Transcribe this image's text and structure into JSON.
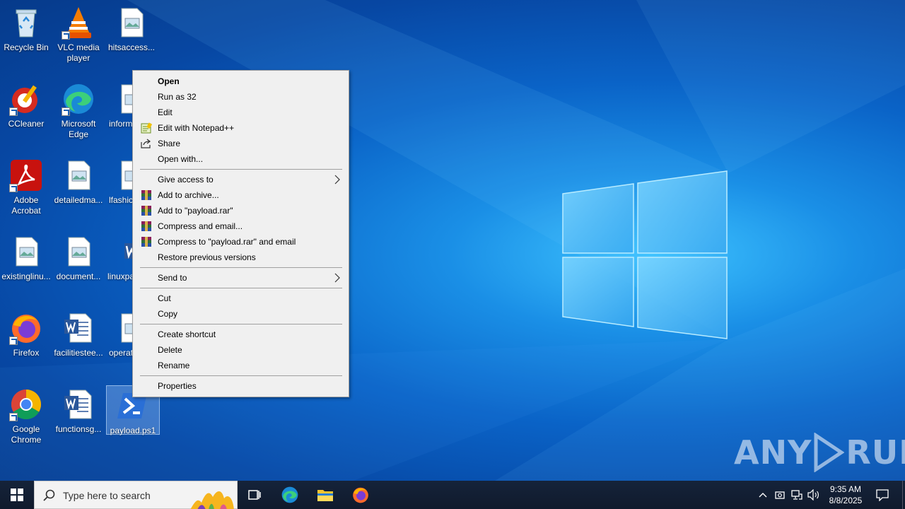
{
  "desktop": {
    "icons": [
      {
        "label": "Recycle Bin"
      },
      {
        "label": "VLC media player"
      },
      {
        "label": "hitsaccess..."
      },
      {
        "label": "CCleaner"
      },
      {
        "label": "Microsoft Edge"
      },
      {
        "label": "inform"
      },
      {
        "label": "Adobe Acrobat"
      },
      {
        "label": "detailedma..."
      },
      {
        "label": "lfashic"
      },
      {
        "label": "existinglinu..."
      },
      {
        "label": "document..."
      },
      {
        "label": "linuxpa"
      },
      {
        "label": "Firefox"
      },
      {
        "label": "facilitiestee..."
      },
      {
        "label": "operat"
      },
      {
        "label": "Google Chrome"
      },
      {
        "label": "functionsg..."
      },
      {
        "label": "payload.ps1"
      }
    ]
  },
  "context_menu": {
    "items": [
      {
        "label": "Open"
      },
      {
        "label": "Run as 32"
      },
      {
        "label": "Edit"
      },
      {
        "label": "Edit with Notepad++"
      },
      {
        "label": "Share"
      },
      {
        "label": "Open with..."
      },
      {
        "label": "Give access to"
      },
      {
        "label": "Add to archive..."
      },
      {
        "label": "Add to \"payload.rar\""
      },
      {
        "label": "Compress and email..."
      },
      {
        "label": "Compress to \"payload.rar\" and email"
      },
      {
        "label": "Restore previous versions"
      },
      {
        "label": "Send to"
      },
      {
        "label": "Cut"
      },
      {
        "label": "Copy"
      },
      {
        "label": "Create shortcut"
      },
      {
        "label": "Delete"
      },
      {
        "label": "Rename"
      },
      {
        "label": "Properties"
      }
    ]
  },
  "taskbar": {
    "search_placeholder": "Type here to search",
    "clock_time": "9:35 AM",
    "clock_date": "8/8/2025"
  },
  "watermark": {
    "left": "ANY",
    "right": "RUN"
  },
  "colors": {
    "desktop_accent": "#0a63c7",
    "menu_bg": "#f0f0f0",
    "taskbar_bg": "#101a2c"
  }
}
